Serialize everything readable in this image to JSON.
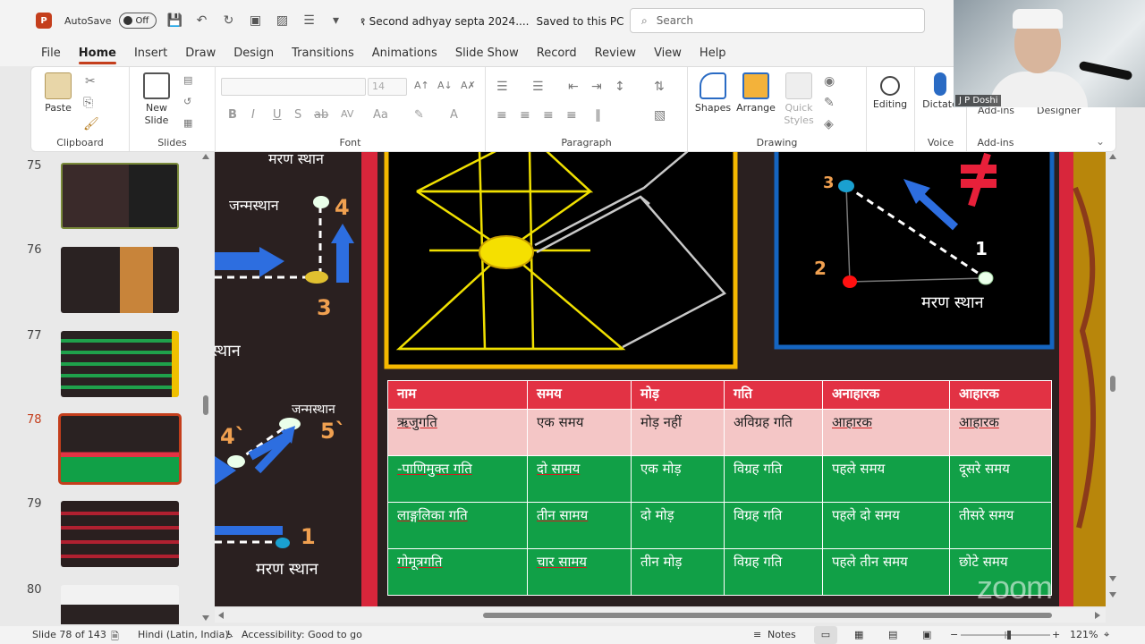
{
  "titlebar": {
    "app_letter": "P",
    "autosave_label": "AutoSave",
    "autosave_state": "Off",
    "doc_title": "१ Second adhyay septa 2024....",
    "saved_status": "Saved to this PC",
    "search_placeholder": "Search"
  },
  "menu": {
    "tabs": [
      "File",
      "Home",
      "Insert",
      "Draw",
      "Design",
      "Transitions",
      "Animations",
      "Slide Show",
      "Record",
      "Review",
      "View",
      "Help"
    ],
    "active": "Home"
  },
  "ribbon": {
    "paste": "Paste",
    "new_slide": "New\nSlide",
    "clipboard": "Clipboard",
    "slides": "Slides",
    "font_size": "14",
    "font": "Font",
    "paragraph": "Paragraph",
    "shapes": "Shapes",
    "arrange": "Arrange",
    "quick_styles": "Quick\nStyles",
    "drawing": "Drawing",
    "editing": "Editing",
    "dictate": "Dictate",
    "voice": "Voice",
    "addins_top": "Add-ins",
    "addins": "Add-ins",
    "designer": "Designer",
    "format_buttons": [
      "B",
      "I",
      "U",
      "S",
      "ab",
      "AV",
      "Aa"
    ]
  },
  "webcam": {
    "participant_name": "J P Doshi"
  },
  "thumbnails": [
    {
      "num": "75",
      "selected": false
    },
    {
      "num": "76",
      "selected": false
    },
    {
      "num": "77",
      "selected": false
    },
    {
      "num": "78",
      "selected": true
    },
    {
      "num": "79",
      "selected": false
    },
    {
      "num": "80",
      "selected": false
    }
  ],
  "slide": {
    "labels": {
      "marana_top": "मरण स्थान",
      "janma_1": "जन्मस्थान",
      "sthaan_mid": "स्थान",
      "janma_2": "जन्मस्थान",
      "marana_bottom": "मरण स्थान",
      "marana_right": "मरण स्थान"
    },
    "numbers": {
      "n4": "4",
      "n3": "3",
      "n4p": "4`",
      "n5p": "5`",
      "n1": "1",
      "r3": "3",
      "r2": "2",
      "r1": "1"
    },
    "not_equal": "≠",
    "table": {
      "headers": [
        "नाम",
        "समय",
        "मोड़",
        "गति",
        "अनाहारक",
        "आहारक"
      ],
      "rows": [
        [
          "ऋजुगति",
          "एक समय",
          "मोड़ नहीं",
          "अविग्रह गति",
          "आहारक",
          "आहारक"
        ],
        [
          "-पाणिमुक्त गति",
          "दो सामय",
          "एक मोड़",
          "विग्रह गति",
          "पहले समय",
          "दूसरे समय"
        ],
        [
          "लाङ्गलिका गति",
          "तीन सामय",
          "दो मोड़",
          "विग्रह गति",
          "पहले दो समय",
          "तीसरे समय"
        ],
        [
          "गोमूत्रगति",
          "चार सामय",
          "तीन मोड़",
          "विग्रह गति",
          "पहले तीन समय",
          "छोटे समय"
        ]
      ]
    },
    "watermark": "zoom"
  },
  "status": {
    "slide_of": "Slide 78 of 143",
    "language": "Hindi (Latin, India)",
    "accessibility": "Accessibility: Good to go",
    "notes": "Notes",
    "zoom": "121%"
  },
  "colors": {
    "accent": "#c43e1c",
    "table_header": "#e23244",
    "table_green": "#11a047",
    "table_pink": "#f4c6c6",
    "slide_bg": "#2a2020",
    "frame_yellow": "#f5b800",
    "frame_blue": "#1565c0",
    "side_red": "#d8263b"
  }
}
